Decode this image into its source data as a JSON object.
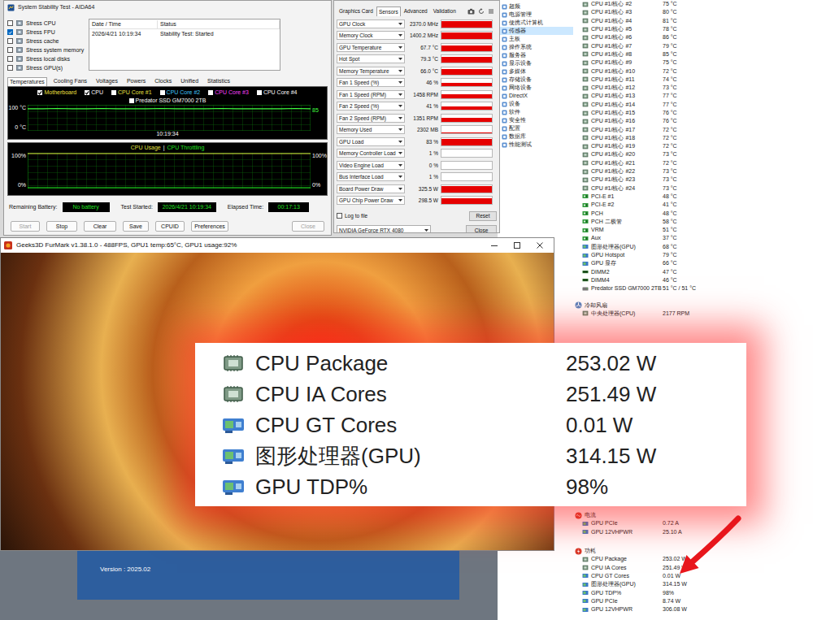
{
  "stability_test": {
    "title": "System Stability Test - AIDA64",
    "stress_options": [
      {
        "label": "Stress CPU",
        "checked": false
      },
      {
        "label": "Stress FPU",
        "checked": true
      },
      {
        "label": "Stress cache",
        "checked": false
      },
      {
        "label": "Stress system memory",
        "checked": false
      },
      {
        "label": "Stress local disks",
        "checked": false
      },
      {
        "label": "Stress GPU(s)",
        "checked": false
      }
    ],
    "log_table": {
      "columns": [
        "Date / Time",
        "Status"
      ],
      "rows": [
        [
          "2026/4/21 10:19:34",
          "Stability Test: Started"
        ]
      ]
    },
    "tabs": [
      {
        "label": "Temperatures",
        "selected": true
      },
      {
        "label": "Cooling Fans",
        "selected": false
      },
      {
        "label": "Voltages",
        "selected": false
      },
      {
        "label": "Powers",
        "selected": false
      },
      {
        "label": "Clocks",
        "selected": false
      },
      {
        "label": "Unified",
        "selected": false
      },
      {
        "label": "Statistics",
        "selected": false
      }
    ],
    "temperature_chart": {
      "legend": [
        {
          "label": "Motherboard",
          "checked": true,
          "color": "#f0e040"
        },
        {
          "label": "CPU",
          "checked": true,
          "color": "#ffffff"
        },
        {
          "label": "CPU Core #1",
          "checked": false,
          "color": "#e8e040"
        },
        {
          "label": "CPU Core #2",
          "checked": false,
          "color": "#40c8ff"
        },
        {
          "label": "CPU Core #3",
          "checked": false,
          "color": "#ff40ff"
        },
        {
          "label": "CPU Core #4",
          "checked": false,
          "color": "#ffffff"
        },
        {
          "label": "Predator SSD GM7000 2TB",
          "checked": false,
          "color": "#ffffff"
        }
      ],
      "axis_top": "100 °C",
      "axis_bottom": "0 °C",
      "current_reading": "85",
      "time_label": "10:19:34",
      "series": [
        {
          "values": [
            85,
            85,
            86,
            85,
            85,
            86,
            85,
            85,
            85,
            86,
            85,
            85,
            85,
            86,
            85,
            85,
            85,
            85,
            86,
            85
          ]
        }
      ]
    },
    "usage_chart": {
      "usage_label": "CPU Usage",
      "separator": "|",
      "throttling_label": "CPU Throttling",
      "left_top": "100%",
      "left_bottom": "0%",
      "right_top": "100%",
      "right_bottom": "0%",
      "usage_values": [
        100,
        100,
        100,
        100,
        100,
        100,
        100,
        100,
        100,
        100,
        100,
        100,
        100,
        100,
        100,
        100,
        100,
        100,
        100,
        100
      ],
      "throttling_values": [
        0,
        0,
        0,
        0,
        0,
        0,
        0,
        0,
        0,
        0,
        0,
        0,
        0,
        0,
        0,
        0,
        0,
        0,
        0,
        0
      ]
    },
    "status": [
      {
        "label": "Remaining Battery:",
        "value": "No battery"
      },
      {
        "label": "Test Started:",
        "value": "2026/4/21 10:19:34"
      },
      {
        "label": "Elapsed Time:",
        "value": "00:17:13"
      }
    ],
    "buttons": [
      {
        "label": "Start",
        "disabled": true
      },
      {
        "label": "Stop",
        "disabled": false
      },
      {
        "label": "Clear",
        "disabled": false
      },
      {
        "label": "Save",
        "disabled": false
      },
      {
        "label": "CPUID",
        "disabled": false
      },
      {
        "label": "Preferences",
        "disabled": false
      },
      {
        "label": "Close",
        "disabled": true
      }
    ]
  },
  "gpuz": {
    "tabs": [
      {
        "label": "Graphics Card",
        "selected": false
      },
      {
        "label": "Sensors",
        "selected": true
      },
      {
        "label": "Advanced",
        "selected": false
      },
      {
        "label": "Validation",
        "selected": false
      }
    ],
    "sensors": [
      {
        "label": "GPU Clock",
        "value": "2370.0 MHz",
        "level": 0.82
      },
      {
        "label": "Memory Clock",
        "value": "1400.2 MHz",
        "level": 0.9
      },
      {
        "label": "GPU Temperature",
        "value": "67.7 °C",
        "level": 0.75
      },
      {
        "label": "Hot Spot",
        "value": "79.3 °C",
        "level": 0.8
      },
      {
        "label": "Memory Temperature",
        "value": "66.0 °C",
        "level": 0.72
      },
      {
        "label": "Fan 1 Speed (%)",
        "value": "46 %",
        "level": 0.5
      },
      {
        "label": "Fan 1 Speed (RPM)",
        "value": "1458 RPM",
        "level": 0.55
      },
      {
        "label": "Fan 2 Speed (%)",
        "value": "41 %",
        "level": 0.45
      },
      {
        "label": "Fan 2 Speed (RPM)",
        "value": "1351 RPM",
        "level": 0.5
      },
      {
        "label": "Memory Used",
        "value": "2302 MB",
        "level": 0.12
      },
      {
        "label": "GPU Load",
        "value": "83 %",
        "level": 0.83
      },
      {
        "label": "Memory Controller Load",
        "value": "1 %",
        "level": 0.02
      },
      {
        "label": "Video Engine Load",
        "value": "0 %",
        "level": 0
      },
      {
        "label": "Bus Interface Load",
        "value": "1 %",
        "level": 0.02
      },
      {
        "label": "Board Power Draw",
        "value": "325.5 W",
        "level": 0.88
      },
      {
        "label": "GPU Chip Power Draw",
        "value": "298.5 W",
        "level": 0.85
      }
    ],
    "log_to_file": {
      "label": "Log to file",
      "checked": false
    },
    "reset_button": "Reset",
    "device": "NVIDIA GeForce RTX 4080",
    "close_button": "Close"
  },
  "sensor_panel": {
    "nav": [
      {
        "label": "超频",
        "selected": false
      },
      {
        "label": "电源管理",
        "selected": false
      },
      {
        "label": "便携式计算机",
        "selected": false
      },
      {
        "label": "传感器",
        "selected": true
      },
      {
        "label": "主板",
        "selected": false
      },
      {
        "label": "操作系统",
        "selected": false
      },
      {
        "label": "服务器",
        "selected": false
      },
      {
        "label": "显示设备",
        "selected": false
      },
      {
        "label": "多媒体",
        "selected": false
      },
      {
        "label": "存储设备",
        "selected": false
      },
      {
        "label": "网络设备",
        "selected": false
      },
      {
        "label": "DirectX",
        "selected": false
      },
      {
        "label": "设备",
        "selected": false
      },
      {
        "label": "软件",
        "selected": false
      },
      {
        "label": "安全性",
        "selected": false
      },
      {
        "label": "配置",
        "selected": false
      },
      {
        "label": "数据库",
        "selected": false
      },
      {
        "label": "性能测试",
        "selected": false
      }
    ],
    "temperature_rows": [
      {
        "label": "CPU #1/核心 #2",
        "value": "75 °C",
        "kind": "cpu"
      },
      {
        "label": "CPU #1/核心 #3",
        "value": "80 °C",
        "kind": "cpu"
      },
      {
        "label": "CPU #1/核心 #4",
        "value": "81 °C",
        "kind": "cpu"
      },
      {
        "label": "CPU #1/核心 #5",
        "value": "78 °C",
        "kind": "cpu"
      },
      {
        "label": "CPU #1/核心 #6",
        "value": "86 °C",
        "kind": "cpu"
      },
      {
        "label": "CPU #1/核心 #7",
        "value": "79 °C",
        "kind": "cpu"
      },
      {
        "label": "CPU #1/核心 #8",
        "value": "85 °C",
        "kind": "cpu"
      },
      {
        "label": "CPU #1/核心 #9",
        "value": "75 °C",
        "kind": "cpu"
      },
      {
        "label": "CPU #1/核心 #10",
        "value": "72 °C",
        "kind": "cpu"
      },
      {
        "label": "CPU #1/核心 #11",
        "value": "74 °C",
        "kind": "cpu"
      },
      {
        "label": "CPU #1/核心 #12",
        "value": "73 °C",
        "kind": "cpu"
      },
      {
        "label": "CPU #1/核心 #13",
        "value": "77 °C",
        "kind": "cpu"
      },
      {
        "label": "CPU #1/核心 #14",
        "value": "77 °C",
        "kind": "cpu"
      },
      {
        "label": "CPU #1/核心 #15",
        "value": "76 °C",
        "kind": "cpu"
      },
      {
        "label": "CPU #1/核心 #16",
        "value": "76 °C",
        "kind": "cpu"
      },
      {
        "label": "CPU #1/核心 #17",
        "value": "72 °C",
        "kind": "cpu"
      },
      {
        "label": "CPU #1/核心 #18",
        "value": "72 °C",
        "kind": "cpu"
      },
      {
        "label": "CPU #1/核心 #19",
        "value": "72 °C",
        "kind": "cpu"
      },
      {
        "label": "CPU #1/核心 #20",
        "value": "73 °C",
        "kind": "cpu"
      },
      {
        "label": "CPU #1/核心 #21",
        "value": "72 °C",
        "kind": "cpu"
      },
      {
        "label": "CPU #1/核心 #22",
        "value": "73 °C",
        "kind": "cpu"
      },
      {
        "label": "CPU #1/核心 #23",
        "value": "73 °C",
        "kind": "cpu"
      },
      {
        "label": "CPU #1/核心 #24",
        "value": "73 °C",
        "kind": "cpu"
      },
      {
        "label": "PCI-E #1",
        "value": "48 °C",
        "kind": "board"
      },
      {
        "label": "PCI-E #2",
        "value": "41 °C",
        "kind": "board"
      },
      {
        "label": "PCH",
        "value": "48 °C",
        "kind": "board"
      },
      {
        "label": "PCH 二极管",
        "value": "58 °C",
        "kind": "board"
      },
      {
        "label": "VRM",
        "value": "51 °C",
        "kind": "board"
      },
      {
        "label": "Aux",
        "value": "37 °C",
        "kind": "board"
      },
      {
        "label": "图形处理器(GPU)",
        "value": "68 °C",
        "kind": "gpu"
      },
      {
        "label": "GPU Hotspot",
        "value": "79 °C",
        "kind": "gpu"
      },
      {
        "label": "GPU 显存",
        "value": "66 °C",
        "kind": "gpu"
      },
      {
        "label": "DIMM2",
        "value": "47 °C",
        "kind": "memory"
      },
      {
        "label": "DIMM4",
        "value": "46 °C",
        "kind": "memory"
      },
      {
        "label": "Predator SSD GM7000 2TB",
        "value": "51 °C / 51 °C",
        "kind": "disk"
      }
    ],
    "sections": [
      {
        "title": "冷却风扇",
        "kind": "fan",
        "rows": [
          {
            "label": "中央处理器(CPU)",
            "value": "2177 RPM",
            "kind": "cpu"
          }
        ]
      },
      {
        "title": "电流",
        "kind": "current",
        "rows": [
          {
            "label": "GPU PCIe",
            "value": "0.72 A",
            "kind": "gpu"
          },
          {
            "label": "GPU 12VHPWR",
            "value": "25.10 A",
            "kind": "gpu"
          }
        ]
      },
      {
        "title": "功耗",
        "kind": "power",
        "rows": [
          {
            "label": "CPU Package",
            "value": "253.02 W",
            "kind": "cpu"
          },
          {
            "label": "CPU IA Cores",
            "value": "251.49 W",
            "kind": "cpu"
          },
          {
            "label": "CPU GT Cores",
            "value": "0.01 W",
            "kind": "gpu"
          },
          {
            "label": "图形处理器(GPU)",
            "value": "314.15 W",
            "kind": "gpu"
          },
          {
            "label": "GPU TDP%",
            "value": "98%",
            "kind": "gpu"
          },
          {
            "label": "GPU PCIe",
            "value": "8.74 W",
            "kind": "gpu"
          },
          {
            "label": "GPU 12VHPWR",
            "value": "306.08 W",
            "kind": "gpu"
          }
        ]
      }
    ]
  },
  "furmark_window": {
    "title": "Geeks3D FurMark v1.38.1.0 - 488FPS, GPU1 temp:65°C, GPU1 usage:92%"
  },
  "background_window": {
    "version_label": "Version : 2025.02"
  },
  "zoom_panel": {
    "rows": [
      {
        "label": "CPU Package",
        "value": "253.02 W",
        "kind": "cpu"
      },
      {
        "label": "CPU IA Cores",
        "value": "251.49 W",
        "kind": "cpu"
      },
      {
        "label": "CPU GT Cores",
        "value": "0.01 W",
        "kind": "gpu"
      },
      {
        "label": "图形处理器(GPU)",
        "value": "314.15 W",
        "kind": "gpu"
      },
      {
        "label": "GPU TDP%",
        "value": "98%",
        "kind": "gpu"
      }
    ]
  }
}
